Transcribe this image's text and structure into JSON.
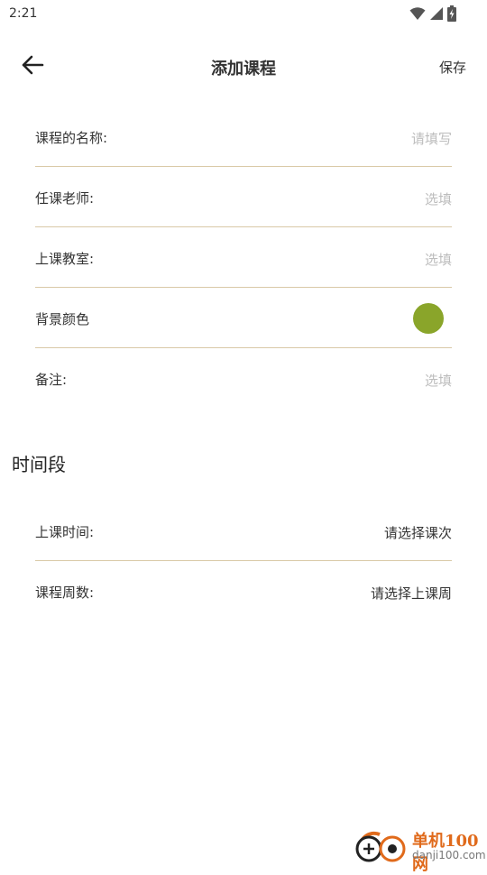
{
  "status_bar": {
    "time": "2:21",
    "icons": [
      "wifi-icon",
      "signal-icon",
      "battery-icon"
    ]
  },
  "app_bar": {
    "back_icon": "arrow-left-icon",
    "title": "添加课程",
    "save_label": "保存"
  },
  "form": {
    "course_name": {
      "label": "课程的名称:",
      "placeholder": "请填写"
    },
    "teacher": {
      "label": "任课老师:",
      "placeholder": "选填"
    },
    "classroom": {
      "label": "上课教室:",
      "placeholder": "选填"
    },
    "background_color": {
      "label": "背景颜色",
      "color": "#8aa52a"
    },
    "note": {
      "label": "备注:",
      "placeholder": "选填"
    }
  },
  "time_section": {
    "title": "时间段",
    "class_time": {
      "label": "上课时间:",
      "value": "请选择课次"
    },
    "weeks": {
      "label": "课程周数:",
      "value": "请选择上课周"
    }
  },
  "watermark": {
    "name": "单机100网",
    "url": "danji100.com"
  },
  "colors": {
    "divider": "#d9c9a7",
    "placeholder": "#bdbdbd",
    "text": "#333333",
    "brand": "#e06a1b"
  }
}
